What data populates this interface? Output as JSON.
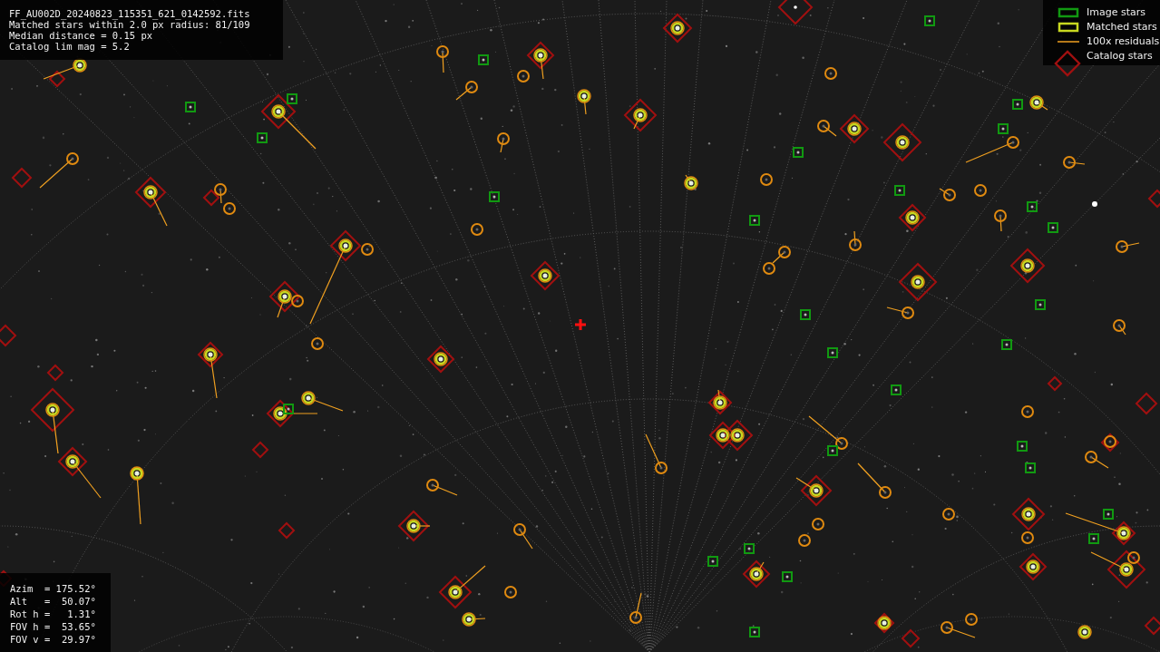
{
  "file_info": {
    "lines": [
      "FF_AU002D_20240823_115351_621_0142592.fits",
      "Matched stars within 2.0 px radius: 81/109",
      "Median distance = 0.15 px",
      "Catalog lim mag = 5.2"
    ]
  },
  "legend": {
    "items": [
      {
        "kind": "image",
        "label": "Image stars"
      },
      {
        "kind": "matched",
        "label": "Matched stars"
      },
      {
        "kind": "residual",
        "label": "100x residuals"
      },
      {
        "kind": "catalog",
        "label": "Catalog stars"
      }
    ]
  },
  "pointing": {
    "lines": [
      "Azim  = 175.52°",
      "Alt   =  50.07°",
      "Rot h =   1.31°",
      "FOV h =  53.65°",
      "FOV v =  29.97°"
    ]
  }
}
